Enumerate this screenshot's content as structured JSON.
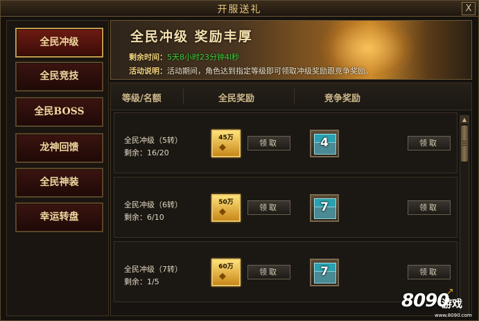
{
  "window": {
    "title": "开服送礼",
    "close_label": "X"
  },
  "sidebar": {
    "items": [
      {
        "label": "全民冲级",
        "active": true
      },
      {
        "label": "全民竞技",
        "active": false
      },
      {
        "label": "全民BOSS",
        "active": false
      },
      {
        "label": "龙神回馈",
        "active": false
      },
      {
        "label": "全民神装",
        "active": false
      },
      {
        "label": "幸运转盘",
        "active": false
      }
    ]
  },
  "banner": {
    "title": "全民冲级 奖励丰厚",
    "time_label": "剩余时间：",
    "time_value": "5天8小时23分钟4l秒",
    "desc_label": "活动说明：",
    "desc_text": "活动期间，角色达到指定等级即可领取冲级奖励跟竞争奖励。"
  },
  "table": {
    "headers": [
      "等级/名额",
      "全民奖励",
      "竞争奖励"
    ],
    "rows": [
      {
        "name": "全民冲级（5转）",
        "remaining": "剩余：16/20",
        "gold_amount": "45万",
        "chest_number": "4",
        "claim_all_label": "领取",
        "claim_comp_label": "领取"
      },
      {
        "name": "全民冲级（6转）",
        "remaining": "剩余：6/10",
        "gold_amount": "50万",
        "chest_number": "7",
        "claim_all_label": "领取",
        "claim_comp_label": "领取"
      },
      {
        "name": "全民冲级（7转）",
        "remaining": "剩余：1/5",
        "gold_amount": "60万",
        "chest_number": "7",
        "claim_all_label": "领取",
        "claim_comp_label": "领取"
      }
    ]
  },
  "watermark": {
    "brand": "8090",
    "zh": "游戏",
    "url": "www.8090.com"
  },
  "colors": {
    "accent_gold": "#e9c77a",
    "countdown_green": "#39d33a",
    "button_red": "#6e1b12"
  }
}
